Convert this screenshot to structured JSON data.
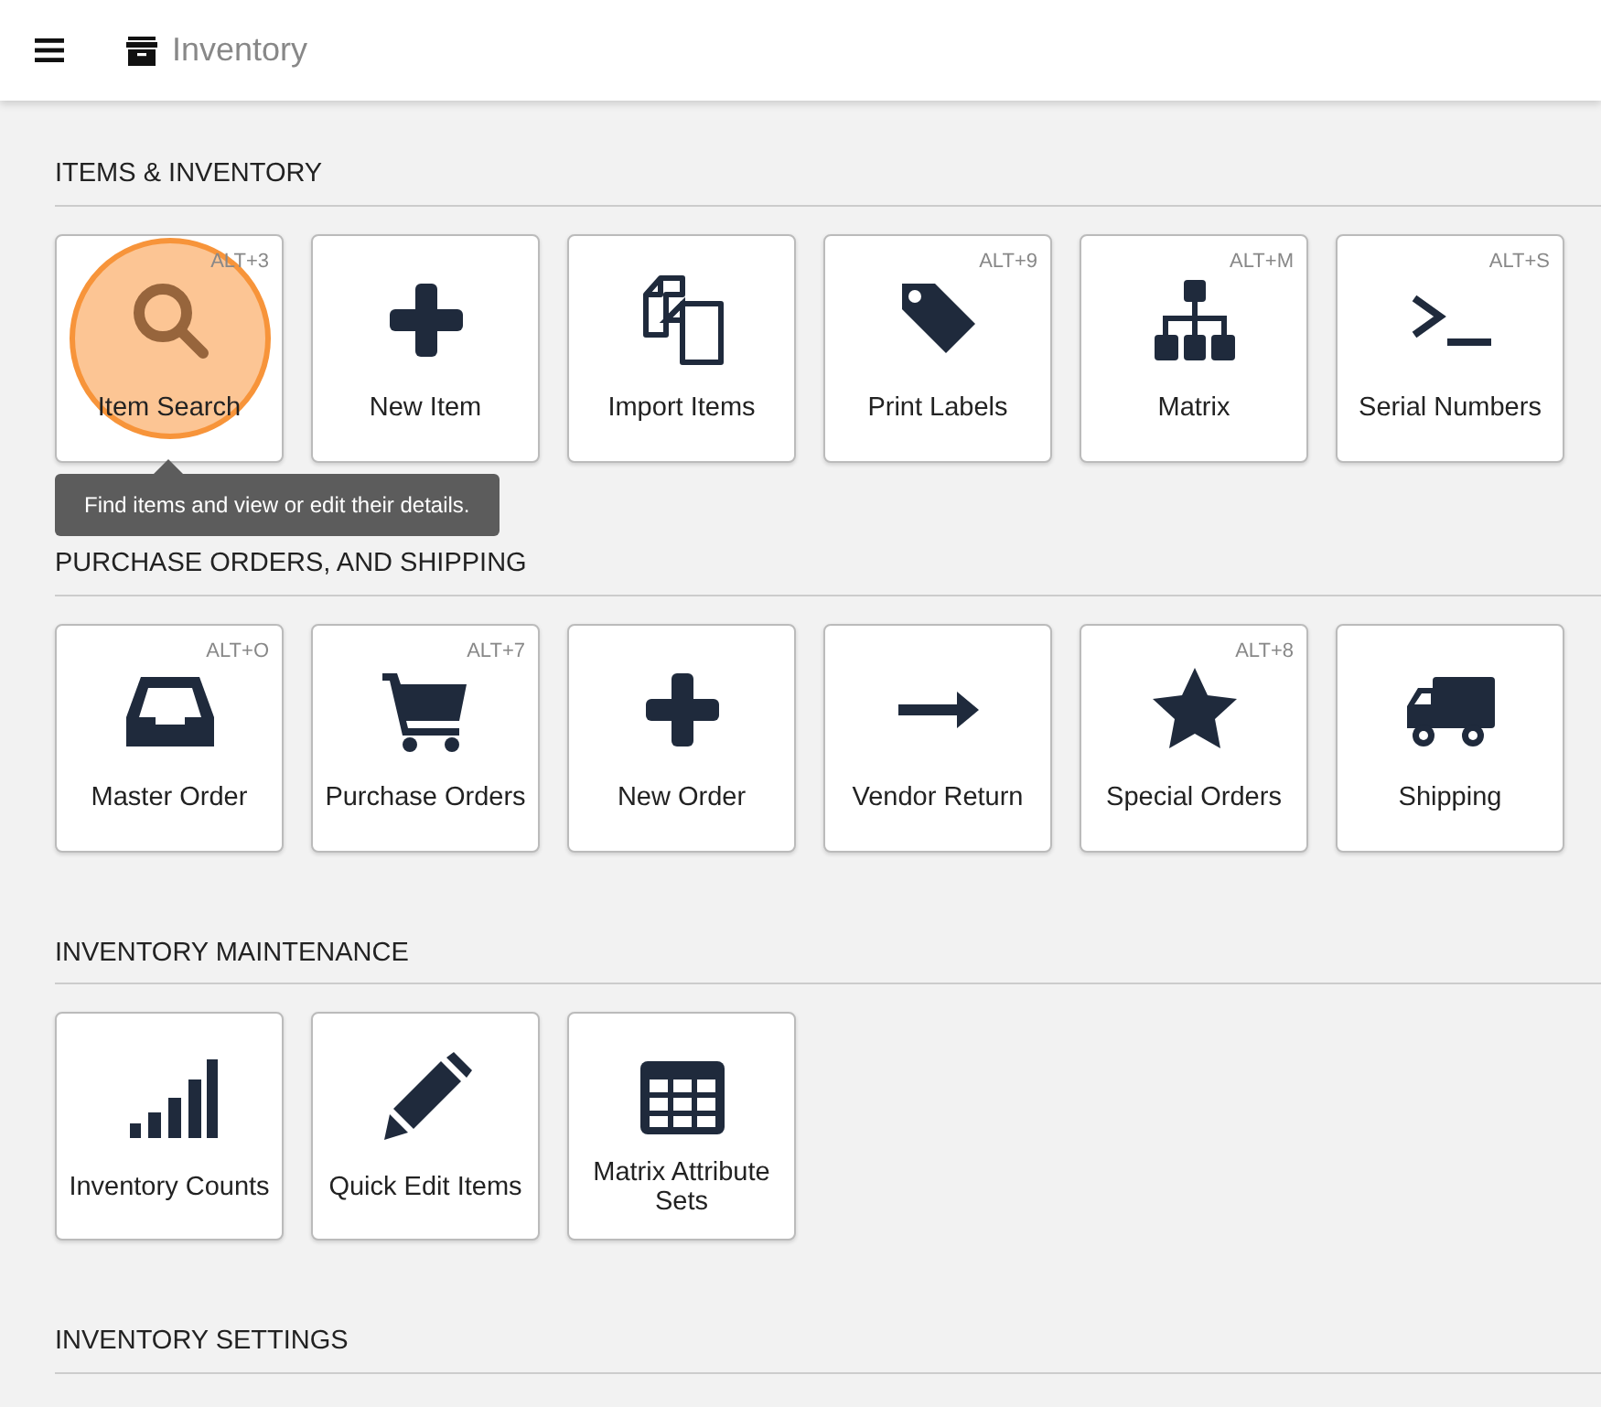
{
  "header": {
    "title": "Inventory"
  },
  "tooltip": {
    "text": "Find items and view or edit their details."
  },
  "sections": [
    {
      "heading": "ITEMS & INVENTORY",
      "tiles": [
        {
          "label": "Item Search",
          "shortcut": "ALT+3"
        },
        {
          "label": "New Item"
        },
        {
          "label": "Import Items"
        },
        {
          "label": "Print Labels",
          "shortcut": "ALT+9"
        },
        {
          "label": "Matrix",
          "shortcut": "ALT+M"
        },
        {
          "label": "Serial Numbers",
          "shortcut": "ALT+S"
        }
      ]
    },
    {
      "heading": "PURCHASE ORDERS, AND SHIPPING",
      "tiles": [
        {
          "label": "Master Order",
          "shortcut": "ALT+O"
        },
        {
          "label": "Purchase Orders",
          "shortcut": "ALT+7"
        },
        {
          "label": "New Order"
        },
        {
          "label": "Vendor Return"
        },
        {
          "label": "Special Orders",
          "shortcut": "ALT+8"
        },
        {
          "label": "Shipping"
        }
      ]
    },
    {
      "heading": "INVENTORY MAINTENANCE",
      "tiles": [
        {
          "label": "Inventory Counts"
        },
        {
          "label": "Quick Edit Items"
        },
        {
          "label": "Matrix Attribute Sets"
        }
      ]
    },
    {
      "heading": "INVENTORY SETTINGS"
    }
  ]
}
